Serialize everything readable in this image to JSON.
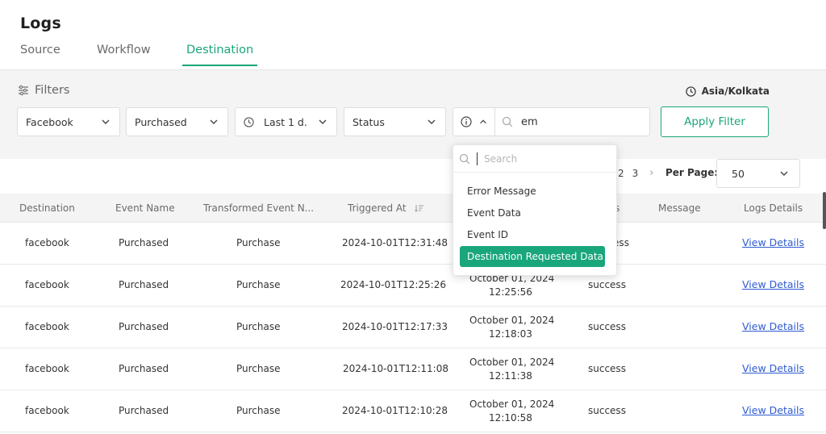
{
  "page": {
    "title": "Logs"
  },
  "tabs": [
    {
      "label": "Source",
      "active": false
    },
    {
      "label": "Workflow",
      "active": false
    },
    {
      "label": "Destination",
      "active": true
    }
  ],
  "filters": {
    "title": "Filters",
    "timezone": "Asia/Kolkata",
    "destination": "Facebook",
    "event": "Purchased",
    "time_range": "Last 1 d...",
    "status": "Status",
    "search_value": "em",
    "apply_label": "Apply Filter"
  },
  "field_dropdown": {
    "search_placeholder": "Search",
    "options": [
      "Error Message",
      "Event Data",
      "Event ID",
      "Destination Requested Data"
    ],
    "selected": "Destination Requested Data"
  },
  "pagination": {
    "pages": [
      "2",
      "3"
    ],
    "next": "›",
    "per_page_label": "Per Page:",
    "per_page_value": "50"
  },
  "table": {
    "headers": [
      "Destination",
      "Event Name",
      "Transformed Event N...",
      "Triggered At",
      "s",
      "Message",
      "Logs Details"
    ],
    "rows": [
      {
        "destination": "facebook",
        "event": "Purchased",
        "transformed": "Purchase",
        "triggered": "2024-10-01T12:31:48",
        "received_date": "",
        "received_time": "",
        "status": "success",
        "link": "View Details"
      },
      {
        "destination": "facebook",
        "event": "Purchased",
        "transformed": "Purchase",
        "triggered": "2024-10-01T12:25:26",
        "received_date": "October 01, 2024",
        "received_time": "12:25:56",
        "status": "success",
        "link": "View Details"
      },
      {
        "destination": "facebook",
        "event": "Purchased",
        "transformed": "Purchase",
        "triggered": "2024-10-01T12:17:33",
        "received_date": "October 01, 2024",
        "received_time": "12:18:03",
        "status": "success",
        "link": "View Details"
      },
      {
        "destination": "facebook",
        "event": "Purchased",
        "transformed": "Purchase",
        "triggered": "2024-10-01T12:11:08",
        "received_date": "October 01, 2024",
        "received_time": "12:11:38",
        "status": "success",
        "link": "View Details"
      },
      {
        "destination": "facebook",
        "event": "Purchased",
        "transformed": "Purchase",
        "triggered": "2024-10-01T12:10:28",
        "received_date": "October 01, 2024",
        "received_time": "12:10:58",
        "status": "success",
        "link": "View Details"
      }
    ]
  },
  "colors": {
    "accent": "#1aa67b",
    "link": "#2f5bd3"
  }
}
